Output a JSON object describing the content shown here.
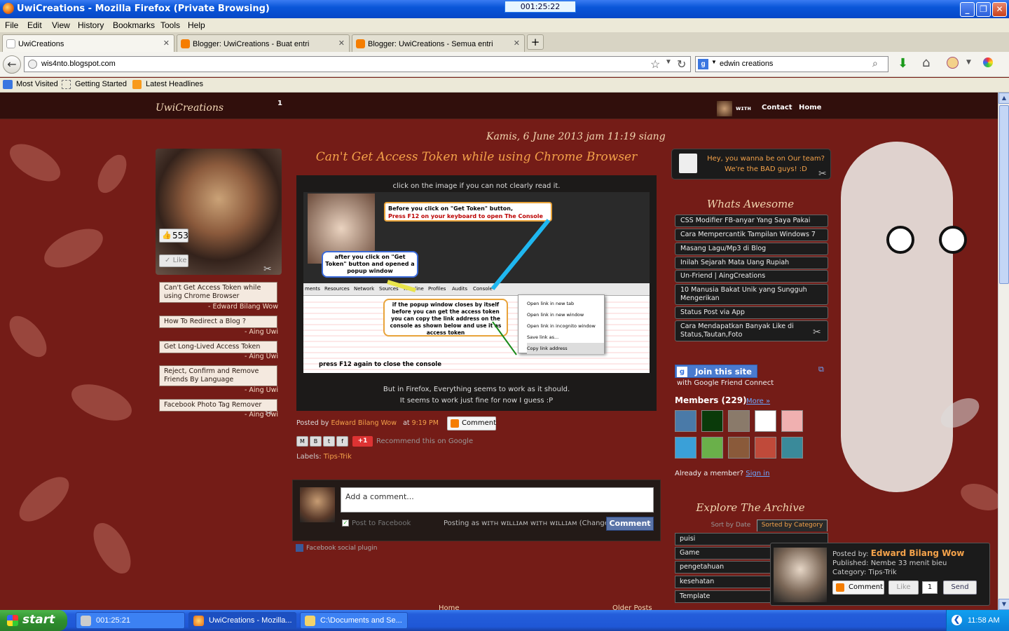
{
  "window": {
    "title": "UwiCreations - Mozilla Firefox (Private Browsing)",
    "timer": "001:25:22"
  },
  "menu": [
    "File",
    "Edit",
    "View",
    "History",
    "Bookmarks",
    "Tools",
    "Help"
  ],
  "tabs": [
    {
      "label": "UwiCreations"
    },
    {
      "label": "Blogger: UwiCreations - Buat entri"
    },
    {
      "label": "Blogger: UwiCreations - Semua entri"
    }
  ],
  "nav": {
    "url": "wis4nto.blogspot.com",
    "search_value": "edwin creations"
  },
  "bookmarks": [
    "Most Visited",
    "Getting Started",
    "Latest Headlines"
  ],
  "page": {
    "brand": "UwiCreations",
    "nav_count": "1",
    "nav_with": "wɪᴛʜ",
    "nav_links": [
      "Contact",
      "Home"
    ],
    "date_line": "Kamis, 6 June 2013 jam 11:19 siang",
    "profile": {
      "like_count": "553",
      "like_label": "Like"
    },
    "recent_posts": [
      {
        "title": "Can't Get Access Token while using Chrome Browser",
        "author": "- Edward Bilang Wow"
      },
      {
        "title": "How To Redirect a Blog ?",
        "author": "- Aing Uwi"
      },
      {
        "title": "Get Long-Lived Access Token",
        "author": "- Aing Uwi"
      },
      {
        "title": "Reject, Confirm and Remove Friends By Language",
        "author": "- Aing Uwi"
      },
      {
        "title": "Facebook Photo Tag Remover",
        "author": "- Aing Uwi"
      }
    ],
    "post": {
      "title": "Can't Get Access Token while using Chrome Browser",
      "caption_top": "click on the image if you can not clearly read it.",
      "caption_bottom_1": "But in Firefox, Everything seems to work as it should.",
      "caption_bottom_2": "It seems to work just fine for now I guess :P",
      "posted_by_label": "Posted by",
      "author": "Edward Bilang Wow",
      "at_label": "at",
      "time": "9:19 PM",
      "comment_label": "Comment",
      "plus_one": "+1",
      "recommend": "Recommend this on Google",
      "labels_prefix": "Labels:",
      "label": "Tips-Trik",
      "shot": {
        "note1a": "Before you click on \"Get Token\" button,",
        "note1b": "Press F12 on your keyboard to open The Console",
        "note2": "after you click on \"Get Token\" button and opened a popup window",
        "note3": "if the popup window closes by itself before you can get the access token you can copy the link address on the console as shown below and use it as access token",
        "note4": "press F12 again to close the console",
        "devtabs": [
          "ments",
          "Resources",
          "Network",
          "Sources",
          "Timeline",
          "Profiles",
          "Audits",
          "Console"
        ],
        "menu": [
          "Open link in new tab",
          "Open link in new window",
          "Open link in incognito window",
          "Save link as...",
          "Copy link address"
        ]
      }
    },
    "fb": {
      "placeholder": "Add a comment...",
      "post_to": "Post to Facebook",
      "posting_as": "Posting as wɪᴛʜ wɪʟʟɪᴀᴍ wɪᴛʜ wɪʟʟɪᴀᴍ (Change)",
      "comment_btn": "Comment",
      "plugin": "Facebook social plugin"
    },
    "footer": {
      "home": "Home",
      "older": "Older Posts"
    },
    "team": "Hey, you wanna be on Our team? We're the BAD guys! :D",
    "whats_awesome_title": "Whats Awesome",
    "awesome": [
      "CSS Modifier FB-anyar Yang Saya Pakai",
      "Cara Mempercantik Tampilan Windows 7",
      "Masang Lagu/Mp3 di Blog",
      "Inilah Sejarah Mata Uang Rupiah",
      "Un-Friend | AingCreations",
      "10 Manusia Bakat Unik yang Sungguh Mengerikan",
      "Status Post via App",
      "Cara Mendapatkan Banyak Like di Status,Tautan,Foto"
    ],
    "gfc": {
      "join": "Join this site",
      "sub": "with Google Friend Connect",
      "members": "Members (229)",
      "more": "More »",
      "already": "Already a member?",
      "signin": "Sign in"
    },
    "archive": {
      "title": "Explore The Archive",
      "sort_date": "Sort by Date",
      "sort_cat": "Sorted by Category",
      "categories": [
        "puisi",
        "Game",
        "pengetahuan",
        "kesehatan",
        "Template"
      ]
    },
    "popup": {
      "posted_by": "Posted by:",
      "author": "Edward Bilang Wow",
      "published": "Published: Nembe 33 menit bieu",
      "category": "Category: Tips-Trik",
      "comment": "Comment",
      "like": "Like",
      "like_count": "1",
      "send": "Send"
    }
  },
  "taskbar": {
    "start": "start",
    "tasks": [
      "001:25:21",
      "UwiCreations - Mozilla...",
      "C:\\Documents and Se..."
    ],
    "clock": "11:58 AM"
  },
  "colors": {
    "accent": "#f4a24a",
    "link": "#6aa6ff",
    "xp_blue": "#245edb"
  }
}
